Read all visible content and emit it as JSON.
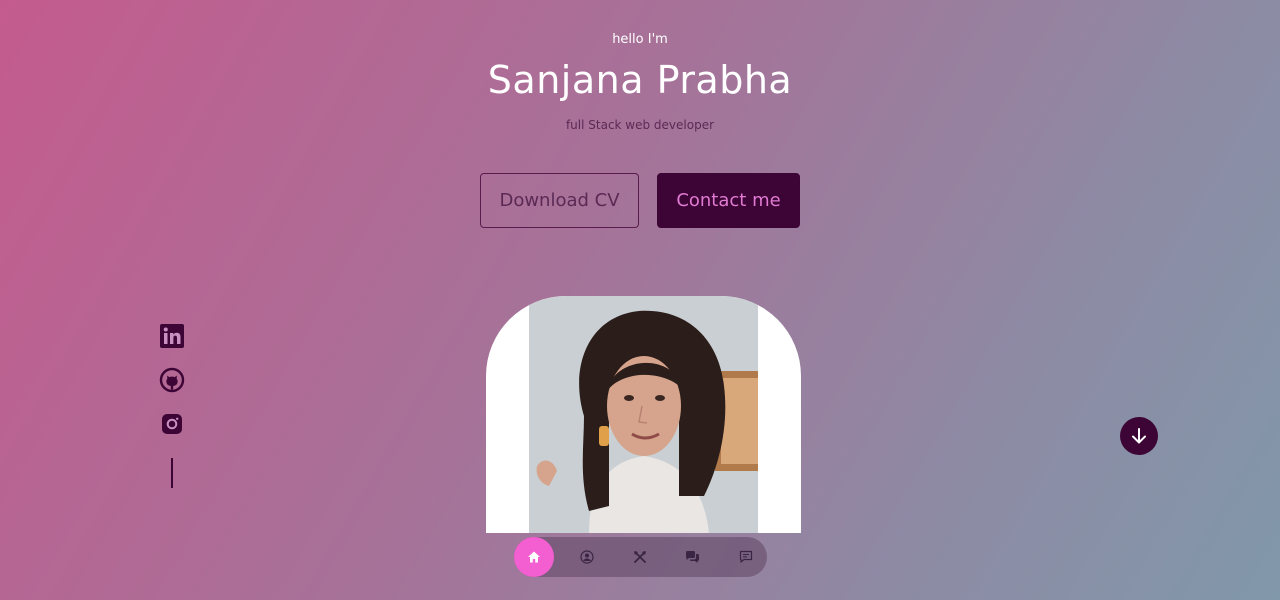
{
  "hero": {
    "greeting": "hello I'm",
    "name": "Sanjana Prabha",
    "subtitle": "full Stack web developer"
  },
  "buttons": {
    "download_cv": "Download CV",
    "contact_me": "Contact me"
  },
  "socials": [
    "linkedin-icon",
    "github-icon",
    "instagram-icon"
  ],
  "profile_photo": {
    "alt": "Sanjana Prabha"
  },
  "nav": {
    "items": [
      "home-icon",
      "user-icon",
      "tools-icon",
      "chat-icon",
      "message-icon"
    ],
    "active": "home-icon"
  },
  "colors": {
    "accent": "#3d0535",
    "nav_active": "#f35fd0",
    "contact_text": "#e07ad2"
  }
}
